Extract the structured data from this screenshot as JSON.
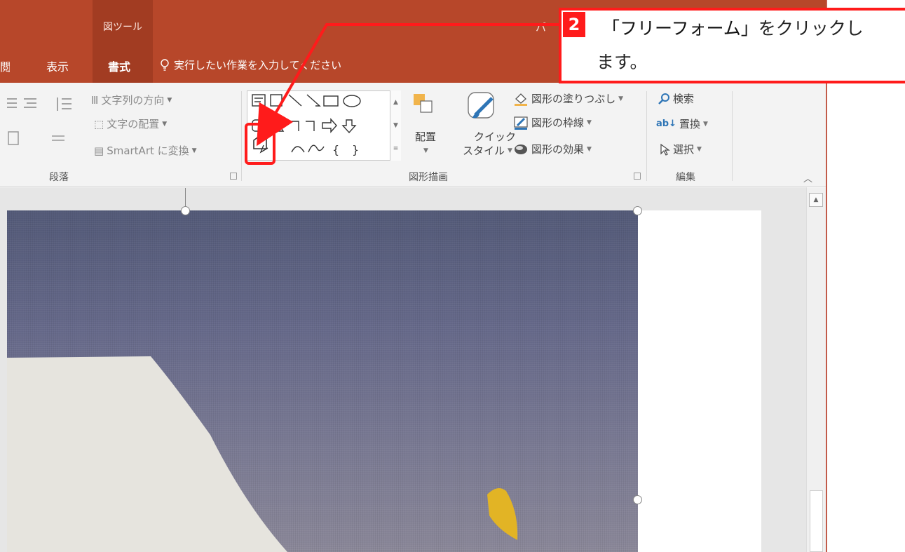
{
  "titlebar": {
    "context_group_label": "図ツール",
    "title_partial": "パ",
    "tabs": {
      "cut_tab": "閲",
      "view": "表示",
      "format": "書式"
    },
    "tell_me": "実行したい作業を入力してください"
  },
  "ribbon": {
    "paragraph": {
      "label": "段落",
      "text_direction": "文字列の方向",
      "align_text": "文字の配置",
      "convert_smartart": "SmartArt に変換"
    },
    "drawing": {
      "label": "図形描画",
      "arrange": "配置",
      "quick_styles_line1": "クイック",
      "quick_styles_line2": "スタイル",
      "shape_fill": "図形の塗りつぶし",
      "shape_outline": "図形の枠線",
      "shape_effects": "図形の効果"
    },
    "editing": {
      "label": "編集",
      "find": "検索",
      "replace": "置換",
      "select": "選択"
    }
  },
  "callout": {
    "step_number": "2",
    "line1_emphasis": "「フリーフォーム」",
    "line1_rest": "をクリックし",
    "line2": "ます。"
  },
  "colors": {
    "title_bar": "#b7472a",
    "context_tab": "#a23c22",
    "callout_red": "#ff1b1b"
  }
}
